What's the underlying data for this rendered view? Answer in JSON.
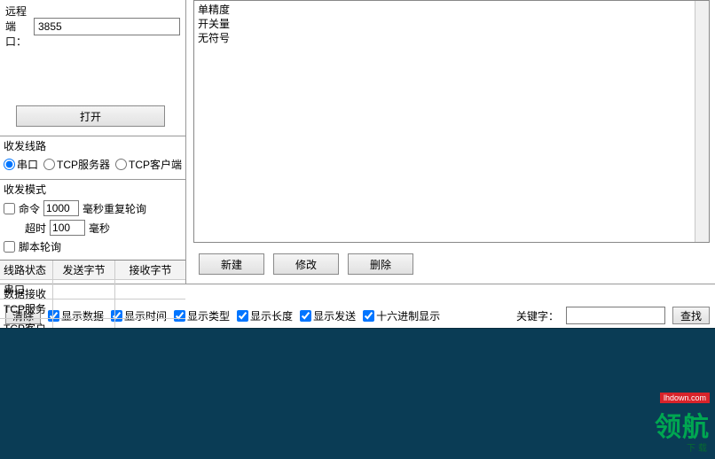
{
  "remote_port": {
    "label": "远程端口：",
    "value": "3855"
  },
  "open_button": "打开",
  "route_section": {
    "title": "收发线路",
    "options": {
      "serial": "串口",
      "tcp_server": "TCP服务器",
      "tcp_client": "TCP客户端"
    }
  },
  "mode_section": {
    "title": "收发模式",
    "cmd_label": "命令",
    "poll_interval": "1000",
    "poll_suffix": "毫秒重复轮询",
    "timeout_label": "超时",
    "timeout_value": "100",
    "timeout_suffix": "毫秒",
    "script_poll": "脚本轮询"
  },
  "status_table": {
    "headers": {
      "c1": "线路状态",
      "c2": "发送字节",
      "c3": "接收字节"
    },
    "rows": [
      "串口",
      "TCP服务",
      "TCP客户"
    ]
  },
  "type_list": [
    "单精度",
    "开关量",
    "无符号"
  ],
  "buttons": {
    "new": "新建",
    "edit": "修改",
    "delete": "删除"
  },
  "recv": {
    "title": "数据接收",
    "clear": "清除",
    "checks": {
      "show_data": "显示数据",
      "show_time": "显示时间",
      "show_type": "显示类型",
      "show_len": "显示长度",
      "show_send": "显示发送",
      "hex": "十六进制显示"
    },
    "keyword_label": "关键字：",
    "find": "查找"
  },
  "watermark": {
    "main": "领航",
    "red": "lhdown.com",
    "sub": "下载"
  }
}
